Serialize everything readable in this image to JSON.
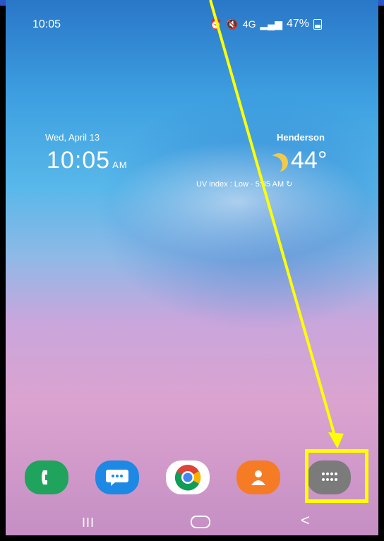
{
  "status_bar": {
    "time": "10:05",
    "icons": [
      "alarm-icon",
      "mute-icon",
      "4g-icon",
      "signal-icon"
    ],
    "network": "4G",
    "battery_percent": "47%"
  },
  "clock_widget": {
    "date": "Wed, April 13",
    "time": "10:05",
    "ampm": "AM",
    "city": "Henderson",
    "temperature": "44°",
    "uv_line": "UV index : Low · 5:35 AM ↻"
  },
  "dock": {
    "apps": [
      {
        "name": "Phone",
        "icon": "phone-icon",
        "color": "#1fa35d"
      },
      {
        "name": "Messages",
        "icon": "messages-icon",
        "color": "#1e88e5"
      },
      {
        "name": "Chrome",
        "icon": "chrome-icon",
        "color": "#ffffff"
      },
      {
        "name": "Contacts",
        "icon": "contacts-icon",
        "color": "#f57c25"
      },
      {
        "name": "Apps",
        "icon": "app-drawer-icon",
        "color": "#7b7b7b"
      }
    ]
  },
  "annotation": {
    "arrow_color": "#ffff00",
    "target": "app-drawer"
  },
  "nav_bar": {
    "recent": "III",
    "back": "<"
  }
}
